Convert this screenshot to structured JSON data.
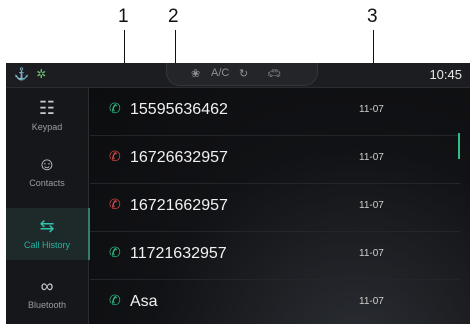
{
  "callouts": [
    "1",
    "2",
    "3"
  ],
  "status": {
    "left_icons": [
      "usb-icon",
      "bluetooth-icon"
    ],
    "center_icons": [
      "fan-icon",
      "recirculation-icon",
      "car-icon"
    ],
    "ac_label": "A/C",
    "time": "10:45"
  },
  "sidebar": {
    "items": [
      {
        "label": "Keypad",
        "icon": "keypad-icon"
      },
      {
        "label": "Contacts",
        "icon": "contacts-icon"
      },
      {
        "label": "Call History",
        "icon": "call-history-icon",
        "active": true
      },
      {
        "label": "Bluetooth",
        "icon": "bluetooth-link-icon"
      }
    ]
  },
  "calls": [
    {
      "name": "15595636462",
      "date": "11-07",
      "type": "incoming"
    },
    {
      "name": "16726632957",
      "date": "11-07",
      "type": "missed"
    },
    {
      "name": "16721662957",
      "date": "11-07",
      "type": "missed"
    },
    {
      "name": "11721632957",
      "date": "11-07",
      "type": "incoming"
    },
    {
      "name": "Asa",
      "date": "11-07",
      "type": "incoming"
    }
  ],
  "colors": {
    "accent": "#2fc3ae",
    "incoming": "#2fbf83",
    "missed": "#d94b4b"
  }
}
